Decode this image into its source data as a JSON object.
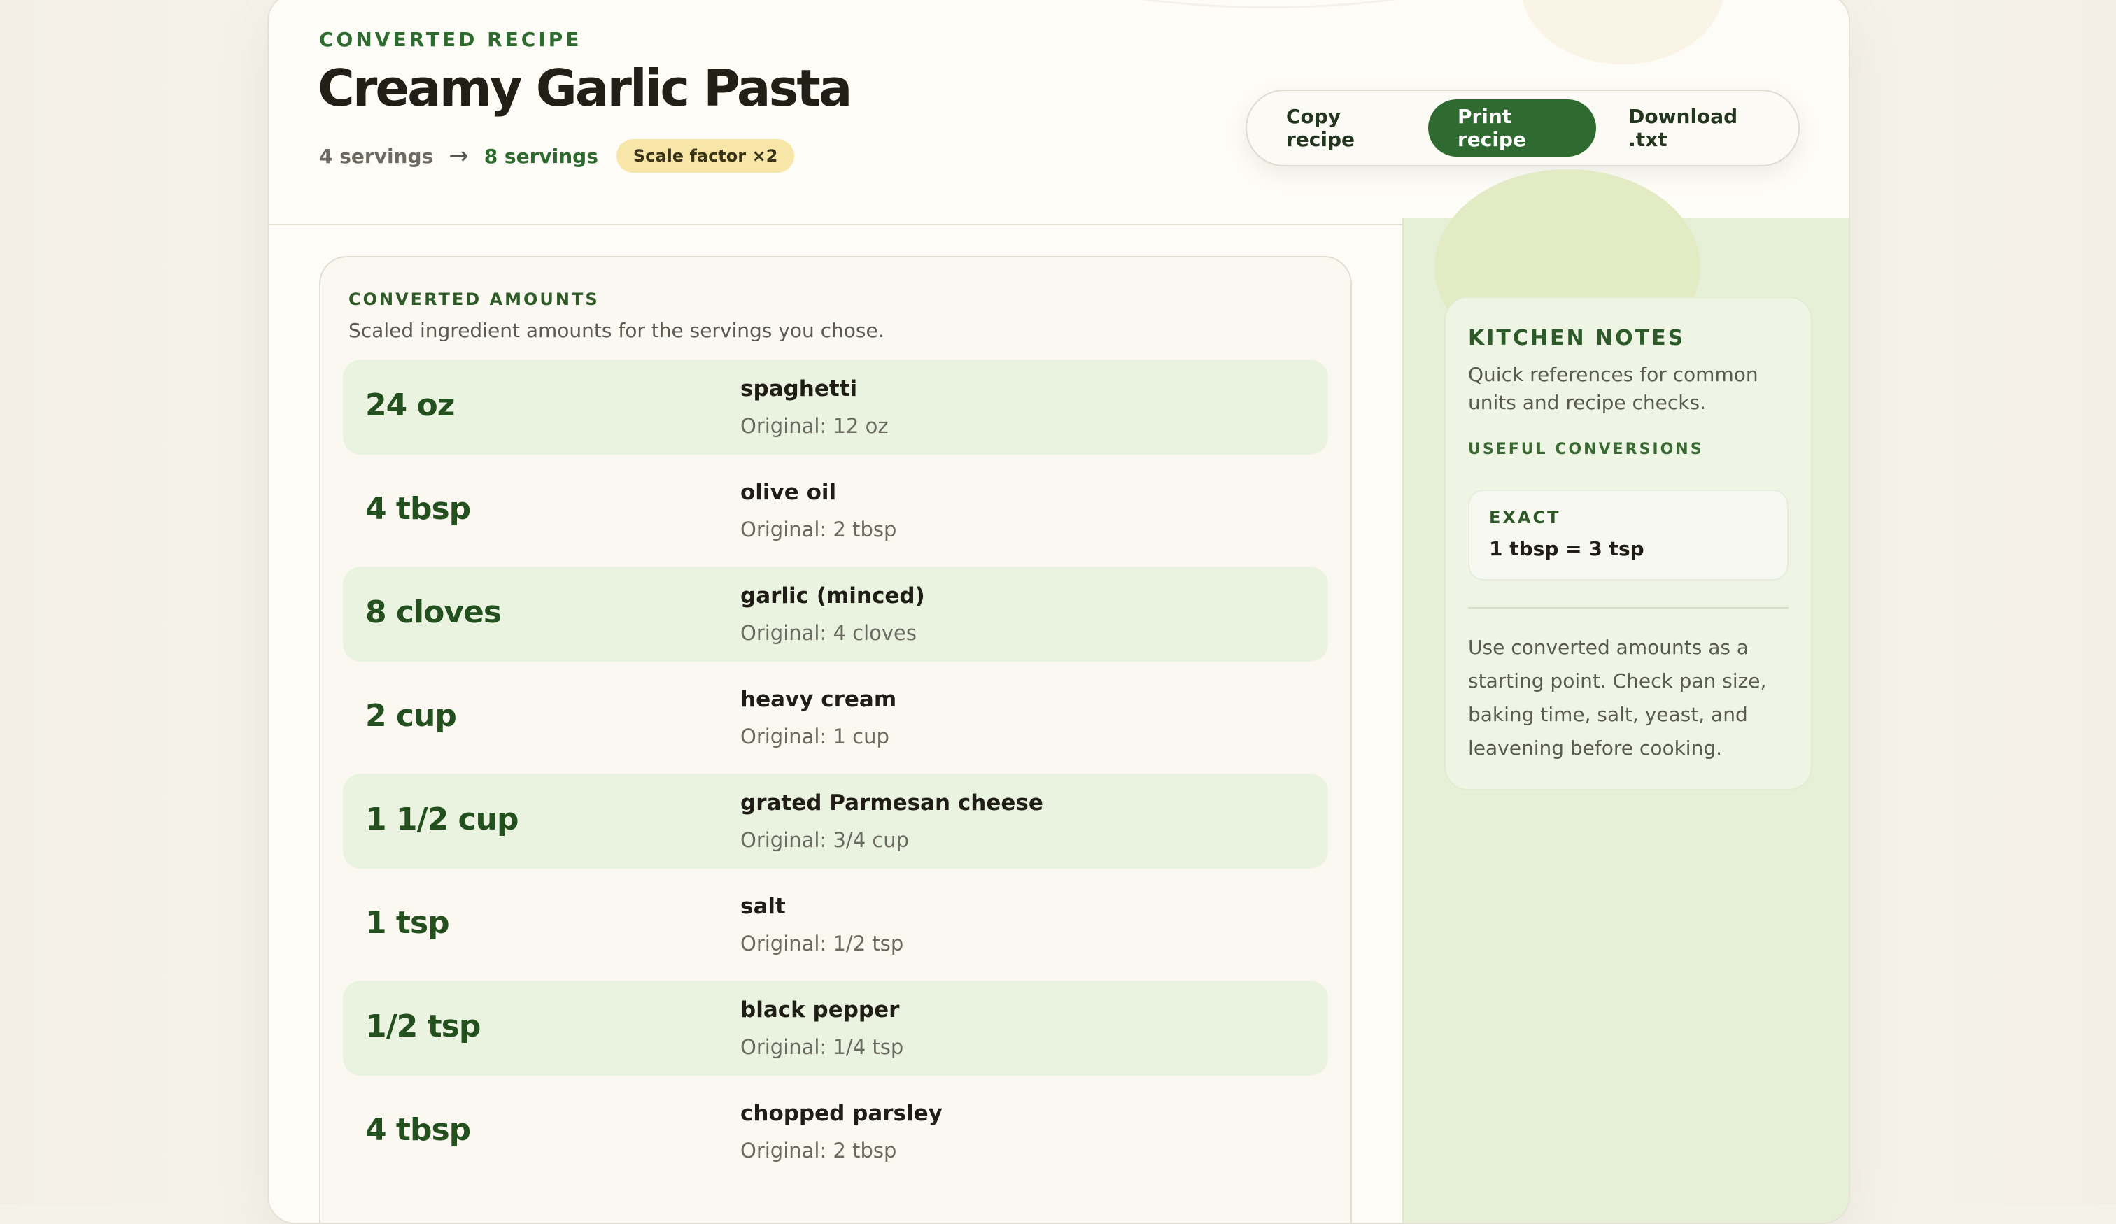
{
  "header": {
    "eyebrow": "CONVERTED RECIPE",
    "title": "Creamy Garlic Pasta",
    "servings_from": "4 servings",
    "arrow": "→",
    "servings_to": "8 servings",
    "scale_badge": "Scale factor ×2"
  },
  "actions": {
    "copy_label": "Copy recipe",
    "print_label": "Print recipe",
    "download_label": "Download .txt"
  },
  "amounts": {
    "eyebrow": "CONVERTED AMOUNTS",
    "subtitle": "Scaled ingredient amounts for the servings you chose.",
    "rows": [
      {
        "amount": "24 oz",
        "name": "spaghetti",
        "original": "Original: 12 oz"
      },
      {
        "amount": "4 tbsp",
        "name": "olive oil",
        "original": "Original: 2 tbsp"
      },
      {
        "amount": "8 cloves",
        "name": "garlic (minced)",
        "original": "Original: 4 cloves"
      },
      {
        "amount": "2 cup",
        "name": "heavy cream",
        "original": "Original: 1 cup"
      },
      {
        "amount": "1 1/2 cup",
        "name": "grated Parmesan cheese",
        "original": "Original: 3/4 cup"
      },
      {
        "amount": "1 tsp",
        "name": "salt",
        "original": "Original: 1/2 tsp"
      },
      {
        "amount": "1/2 tsp",
        "name": "black pepper",
        "original": "Original: 1/4 tsp"
      },
      {
        "amount": "4 tbsp",
        "name": "chopped parsley",
        "original": "Original: 2 tbsp"
      }
    ]
  },
  "notes": {
    "title": "KITCHEN NOTES",
    "subtitle": "Quick references for common units and recipe checks.",
    "conversions_label": "USEFUL CONVERSIONS",
    "exact_label": "EXACT",
    "exact_value": "1 tbsp = 3 tsp",
    "body": "Use converted amounts as a starting point. Check pan size, baking time, salt, yeast, and leavening before cooking."
  },
  "colors": {
    "accent_green": "#2f6a30",
    "row_shade": "#eaf3e0",
    "badge_yellow": "#f8e6a8",
    "sidebar_bg": "#e5f0d6"
  }
}
